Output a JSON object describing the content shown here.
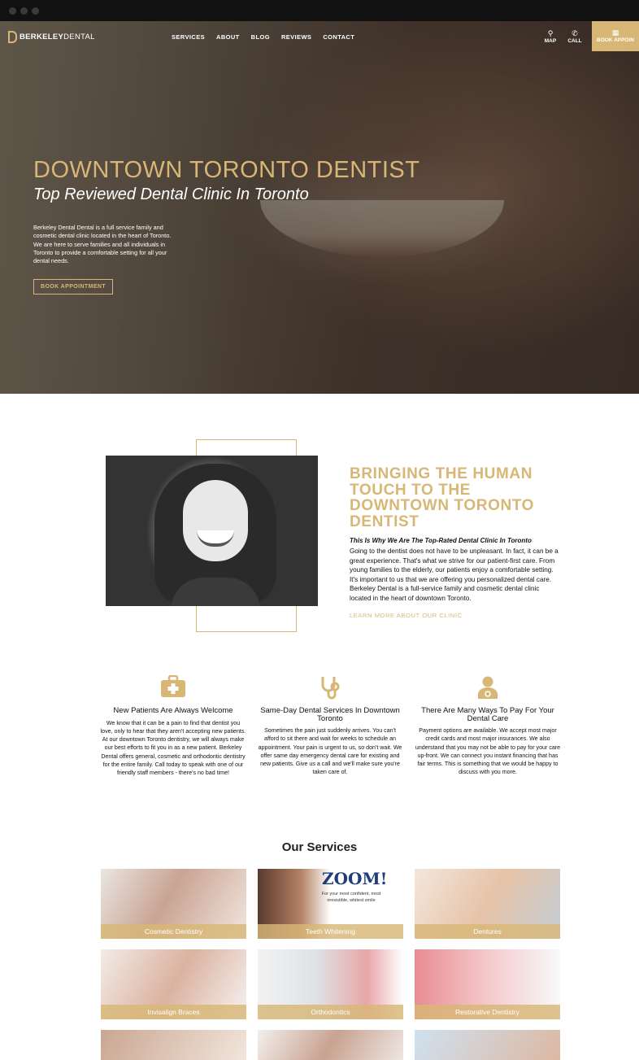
{
  "nav": {
    "logo_bold": "BERKELEY",
    "logo_thin": "DENTAL",
    "menu": [
      "SERVICES",
      "ABOUT",
      "BLOG",
      "REVIEWS",
      "CONTACT"
    ],
    "map_label": "MAP",
    "call_label": "CALL",
    "book_label": "BOOK APPOIN",
    "icons": {
      "map": "map-pin-icon",
      "call": "phone-icon",
      "book": "calendar-icon"
    }
  },
  "hero": {
    "title": "DOWNTOWN TORONTO DENTIST",
    "subtitle": "Top Reviewed Dental Clinic In Toronto",
    "text": "Berkeley Dental Dental is a full service family and cosmetic dental clinic located in the heart of Toronto. We are here to serve families and all individuals in Toronto to provide a comfortable setting for all your dental needs.",
    "button": "BOOK APPOINTMENT"
  },
  "about": {
    "title": "BRINGING THE HUMAN TOUCH TO THE DOWNTOWN TORONTO DENTIST",
    "subtitle": "This Is Why We Are The Top-Rated Dental Clinic In Toronto",
    "text": "Going to the dentist does not have to be unpleasant. In fact, it can be a great experience. That's what we strive for our patient-first care. From young families to the elderly, our patients enjoy a comfortable setting. It's important to us that we are offering you personalized dental care. Berkeley Dental is a full-service family and cosmetic dental clinic located in the heart of downtown Toronto.",
    "link": "LEARN MORE ABOUT OUR CLINIC"
  },
  "features": [
    {
      "icon": "first-aid-kit-icon",
      "title": "New Patients Are Always Welcome",
      "text": "We know that it can be a pain to find that dentist you love, only to hear that they aren't accepting new patients. At our downtown Toronto dentistry, we will always make our best efforts to fit you in as a new patient. Berkeley Dental offers general, cosmetic and orthodontic dentistry for the entire family. Call today to speak with one of our friendly staff members - there's no bad time!"
    },
    {
      "icon": "stethoscope-icon",
      "title": "Same-Day Dental Services In Downtown Toronto",
      "text": "Sometimes the pain just suddenly arrives. You can't afford to sit there and wait for weeks to schedule an appointment. Your pain is urgent to us, so don't wait. We offer same day emergency dental care for existing and new patients. Give us a call and we'll make sure you're taken care of."
    },
    {
      "icon": "doctor-icon",
      "title": "There Are Many Ways To Pay For Your Dental Care",
      "text": "Payment options are available. We accept most major credit cards and most major insurances. We also understand that you may not be able to pay for your care up-front. We can connect you instant financing that has fair terms. This is something that we would be happy to discuss with you more."
    }
  ],
  "services": {
    "title": "Our Services",
    "zoom_logo": "ZOOM!",
    "zoom_text": "For your most confident, most irresistible, whitest smile",
    "items": [
      "Cosmetic Dentistry",
      "Teeth Whitening",
      "Dentures",
      "Invisalign Braces",
      "Orthodontics",
      "Restorative Dentistry",
      "",
      "",
      ""
    ]
  },
  "colors": {
    "gold": "#d8b776"
  }
}
